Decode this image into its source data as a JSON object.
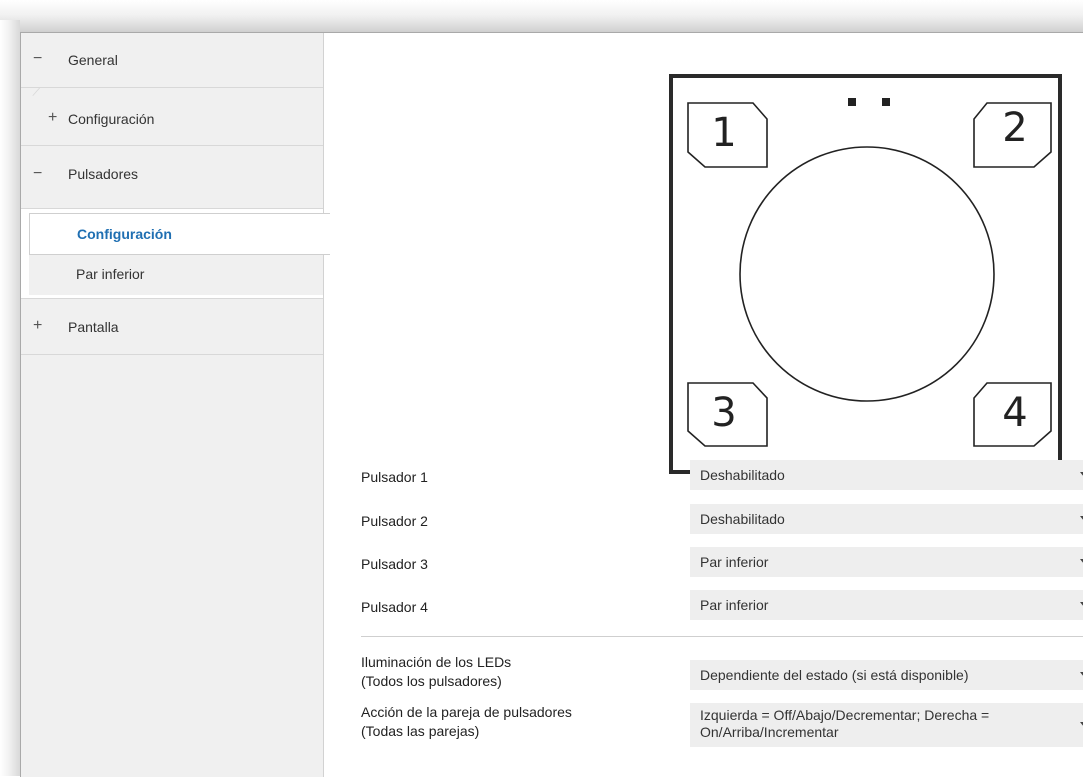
{
  "sidebar": {
    "items": [
      {
        "symbol": "−",
        "label": "General"
      },
      {
        "symbol": "+",
        "label": "Configuración"
      },
      {
        "symbol": "−",
        "label": "Pulsadores"
      },
      {
        "label": "Configuración",
        "active": true
      },
      {
        "label": "Par inferior"
      },
      {
        "symbol": "+",
        "label": "Pantalla"
      }
    ]
  },
  "diagram": {
    "keys": [
      "1",
      "2",
      "3",
      "4"
    ]
  },
  "params": [
    {
      "label": "Pulsador 1",
      "value": "Deshabilitado"
    },
    {
      "label": "Pulsador 2",
      "value": "Deshabilitado"
    },
    {
      "label": "Pulsador 3",
      "value": "Par inferior"
    },
    {
      "label": "Pulsador 4",
      "value": "Par inferior"
    }
  ],
  "leds": {
    "label_line1": "Iluminación de los LEDs",
    "label_line2": "(Todos los pulsadores)",
    "value": "Dependiente del estado (si está disponible)"
  },
  "pair_action": {
    "label_line1": "Acción de la pareja de pulsadores",
    "label_line2": "(Todas las parejas)",
    "value_line1": "Izquierda = Off/Abajo/Decrementar; Derecha =",
    "value_line2": "On/Arriba/Incrementar"
  },
  "colors": {
    "active_text": "#1f6fb2",
    "sidebar_bg": "#f0f0f0",
    "select_bg": "#eeeeee"
  }
}
